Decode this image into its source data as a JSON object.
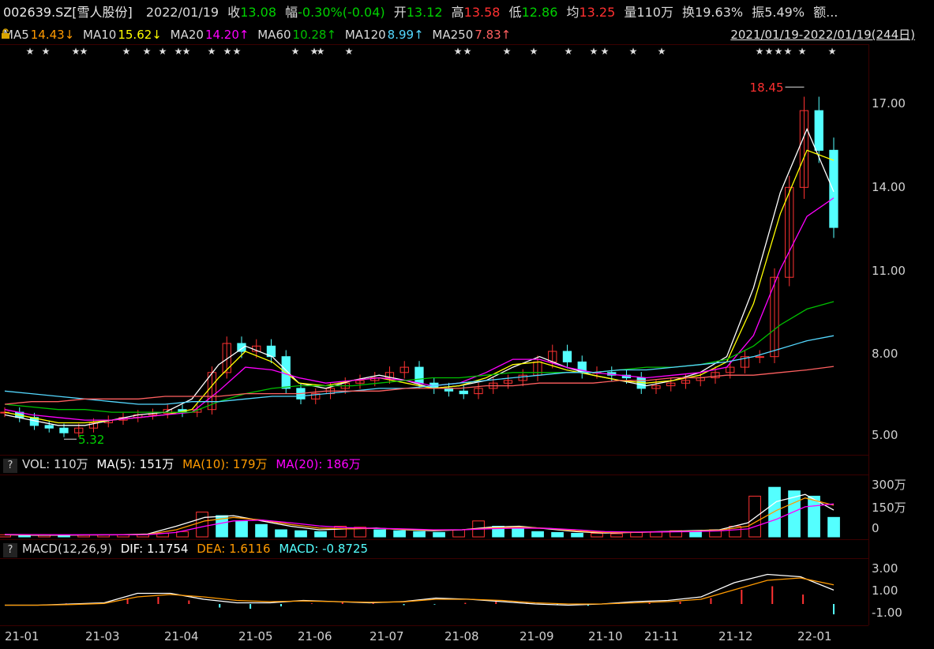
{
  "header": {
    "symbol": "002639.SZ[雪人股份]",
    "date": "2022/01/19",
    "close_label": "收",
    "close": "13.08",
    "change_label": "幅",
    "change": "-0.30%(-0.04)",
    "open_label": "开",
    "open": "13.12",
    "high_label": "高",
    "high": "13.58",
    "low_label": "低",
    "low": "12.86",
    "avg_label": "均",
    "avg": "13.25",
    "vol_label": "量",
    "vol": "110万",
    "turnover_label": "换",
    "turnover": "19.63%",
    "amplitude_label": "振",
    "amplitude": "5.49%",
    "amount_label": "额..."
  },
  "ma_line": {
    "ma5": "MA5",
    "ma5_val": "14.43↓",
    "ma10": "MA10",
    "ma10_val": "15.62↓",
    "ma20": "MA20",
    "ma20_val": "14.20↑",
    "ma60": "MA60",
    "ma60_val": "10.28↑",
    "ma120": "MA120",
    "ma120_val": "8.99↑",
    "ma250": "MA250",
    "ma250_val": "7.83↑",
    "range": "2021/01/19-2022/01/19(244日)"
  },
  "vol_panel": {
    "q": "?",
    "vol": "VOL: 110万",
    "ma5": "MA(5): 151万",
    "ma10": "MA(10): 179万",
    "ma20": "MA(20): 186万"
  },
  "macd_panel": {
    "q": "?",
    "title": "MACD(12,26,9)",
    "dif": "DIF: 1.1754",
    "dea": "DEA: 1.6116",
    "macd": "MACD: -0.8725"
  },
  "colors": {
    "up": "#ff3232",
    "down": "#54ffff",
    "ma5": "#ffffff",
    "ma10": "#ffff00",
    "ma20": "#ff00ff",
    "ma60": "#00c000",
    "ma120": "#54d8ff",
    "ma250": "#ff6060",
    "green_text": "#00d000",
    "red_text": "#ff3030",
    "orange": "#ff9a00"
  },
  "chart_data": [
    {
      "type": "candlestick",
      "ylim": [
        4.7,
        19.8
      ],
      "y_ticks": [
        "17.00",
        "14.00",
        "11.00",
        "8.00",
        "5.00"
      ],
      "x_ticks": [
        "21-01",
        "21-03",
        "21-04",
        "21-05",
        "21-06",
        "21-07",
        "21-08",
        "21-09",
        "21-10",
        "21-11",
        "21-12",
        "22-01"
      ],
      "annotations": {
        "high": "18.45",
        "low": "5.32"
      },
      "close_series": [
        6.1,
        5.9,
        5.6,
        5.5,
        5.32,
        5.5,
        5.7,
        5.8,
        5.9,
        6.0,
        6.05,
        6.2,
        6.1,
        6.2,
        7.6,
        8.7,
        8.4,
        8.6,
        8.2,
        7.0,
        6.6,
        6.8,
        7.0,
        7.2,
        7.3,
        7.4,
        7.6,
        7.8,
        7.2,
        7.0,
        6.9,
        6.8,
        7.0,
        7.2,
        7.3,
        7.5,
        8.0,
        8.4,
        8.0,
        7.6,
        7.6,
        7.5,
        7.4,
        7.0,
        7.1,
        7.2,
        7.3,
        7.4,
        7.6,
        7.8,
        8.2,
        8.2,
        11.2,
        14.6,
        17.5,
        16.0,
        13.08
      ],
      "series": [
        {
          "name": "MA5",
          "values": [
            6.0,
            5.8,
            5.6,
            5.6,
            5.8,
            6.0,
            6.1,
            6.6,
            7.9,
            8.6,
            8.2,
            7.2,
            7.0,
            7.3,
            7.5,
            7.3,
            7.0,
            7.1,
            7.3,
            7.8,
            8.2,
            7.8,
            7.5,
            7.3,
            7.1,
            7.3,
            7.6,
            8.2,
            10.8,
            14.4,
            16.8,
            14.43
          ]
        },
        {
          "name": "MA10",
          "values": [
            6.1,
            5.9,
            5.7,
            5.7,
            5.8,
            5.9,
            6.0,
            6.2,
            7.4,
            8.4,
            8.0,
            7.2,
            7.1,
            7.3,
            7.4,
            7.2,
            7.0,
            7.1,
            7.4,
            7.9,
            8.0,
            7.7,
            7.5,
            7.3,
            7.2,
            7.3,
            7.5,
            8.0,
            10.2,
            13.6,
            16.0,
            15.62
          ]
        },
        {
          "name": "MA20",
          "values": [
            6.2,
            6.0,
            5.9,
            5.8,
            5.8,
            5.9,
            6.0,
            6.1,
            6.9,
            7.8,
            7.7,
            7.4,
            7.2,
            7.3,
            7.4,
            7.3,
            7.1,
            7.2,
            7.6,
            8.1,
            8.1,
            7.8,
            7.6,
            7.5,
            7.4,
            7.5,
            7.6,
            7.8,
            9.0,
            11.5,
            13.5,
            14.2
          ]
        },
        {
          "name": "MA60",
          "values": [
            6.4,
            6.3,
            6.2,
            6.2,
            6.1,
            6.1,
            6.1,
            6.1,
            6.5,
            6.8,
            7.0,
            7.1,
            7.1,
            7.1,
            7.2,
            7.3,
            7.4,
            7.4,
            7.5,
            7.6,
            7.6,
            7.6,
            7.6,
            7.7,
            7.8,
            7.8,
            7.9,
            8.1,
            8.6,
            9.4,
            10.0,
            10.28
          ]
        },
        {
          "name": "MA120",
          "values": [
            6.9,
            6.8,
            6.7,
            6.6,
            6.5,
            6.4,
            6.4,
            6.5,
            6.5,
            6.6,
            6.7,
            6.7,
            6.8,
            6.9,
            7.0,
            7.0,
            7.1,
            7.2,
            7.3,
            7.4,
            7.5,
            7.6,
            7.6,
            7.7,
            7.7,
            7.8,
            7.9,
            8.0,
            8.2,
            8.5,
            8.8,
            8.99
          ]
        },
        {
          "name": "MA250",
          "values": [
            6.4,
            6.5,
            6.5,
            6.6,
            6.6,
            6.6,
            6.7,
            6.7,
            6.7,
            6.8,
            6.8,
            6.8,
            6.9,
            6.9,
            6.9,
            7.0,
            7.0,
            7.0,
            7.1,
            7.1,
            7.2,
            7.2,
            7.2,
            7.3,
            7.3,
            7.4,
            7.4,
            7.5,
            7.5,
            7.6,
            7.7,
            7.83
          ]
        }
      ]
    },
    {
      "type": "bar",
      "name": "VOL",
      "y_ticks": [
        "300万",
        "150万",
        "0"
      ],
      "ylim": [
        0,
        330
      ],
      "values": [
        12,
        10,
        9,
        8,
        10,
        11,
        12,
        14,
        20,
        30,
        140,
        120,
        90,
        70,
        40,
        35,
        30,
        60,
        55,
        40,
        35,
        30,
        25,
        40,
        90,
        60,
        45,
        30,
        25,
        20,
        20,
        18,
        25,
        30,
        35,
        30,
        40,
        60,
        230,
        280,
        260,
        230,
        110
      ],
      "series": [
        {
          "name": "MA(5)",
          "values": [
            12,
            10,
            10,
            11,
            12,
            16,
            60,
            110,
            120,
            90,
            60,
            40,
            45,
            50,
            40,
            35,
            40,
            55,
            60,
            45,
            30,
            22,
            25,
            30,
            35,
            40,
            80,
            200,
            240,
            151
          ]
        },
        {
          "name": "MA(10)",
          "values": [
            13,
            12,
            11,
            11,
            12,
            14,
            40,
            90,
            110,
            95,
            70,
            50,
            45,
            48,
            42,
            38,
            40,
            50,
            55,
            48,
            34,
            25,
            25,
            28,
            32,
            38,
            60,
            150,
            220,
            179
          ]
        },
        {
          "name": "MA(20)",
          "values": [
            14,
            13,
            12,
            12,
            12,
            13,
            25,
            60,
            90,
            95,
            80,
            62,
            52,
            48,
            45,
            40,
            40,
            46,
            50,
            48,
            40,
            30,
            27,
            28,
            30,
            34,
            45,
            100,
            170,
            186
          ]
        }
      ]
    },
    {
      "type": "bar",
      "name": "MACD",
      "y_ticks": [
        "3.00",
        "1.00",
        "-1.00"
      ],
      "ylim": [
        -1.6,
        3.6
      ],
      "values": [
        0.0,
        0.0,
        0.05,
        0.1,
        0.5,
        0.6,
        0.3,
        -0.3,
        -0.4,
        -0.2,
        0.05,
        0.2,
        0.1,
        -0.1,
        -0.05,
        0.1,
        0.3,
        0.1,
        -0.1,
        -0.15,
        0.05,
        0.1,
        0.2,
        0.5,
        1.2,
        1.5,
        0.8,
        -0.8728
      ],
      "series": [
        {
          "name": "DIF",
          "values": [
            -0.1,
            -0.1,
            0.0,
            0.1,
            0.9,
            0.9,
            0.4,
            0.1,
            0.1,
            0.3,
            0.2,
            0.1,
            0.2,
            0.5,
            0.4,
            0.2,
            0.0,
            -0.1,
            0.0,
            0.2,
            0.3,
            0.6,
            1.8,
            2.5,
            2.3,
            1.1754
          ]
        },
        {
          "name": "DEA",
          "values": [
            -0.1,
            -0.1,
            -0.05,
            0.05,
            0.6,
            0.8,
            0.6,
            0.3,
            0.2,
            0.25,
            0.2,
            0.15,
            0.18,
            0.4,
            0.4,
            0.3,
            0.1,
            0.0,
            0.0,
            0.1,
            0.2,
            0.4,
            1.2,
            2.0,
            2.2,
            1.6116
          ]
        }
      ]
    }
  ]
}
